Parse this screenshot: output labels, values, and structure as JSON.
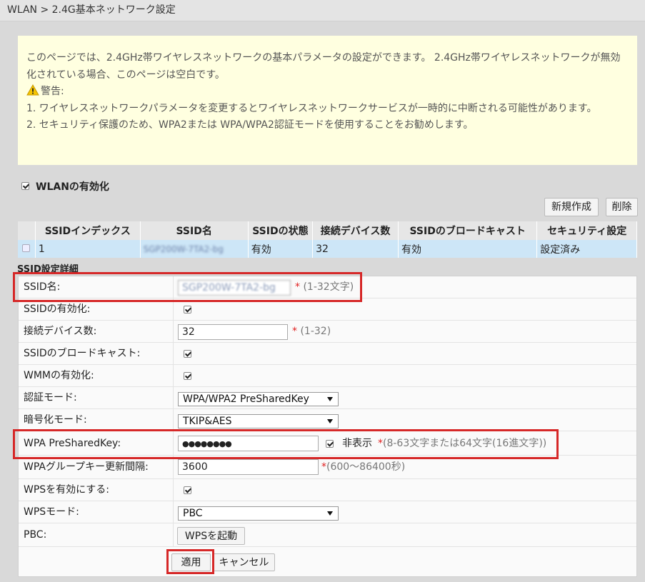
{
  "breadcrumb": "WLAN > 2.4G基本ネットワーク設定",
  "notice": {
    "line1": "このページでは、2.4GHz帯ワイヤレスネットワークの基本パラメータの設定ができます。 2.4GHz帯ワイヤレスネットワークが無効化されている場合、このページは空白です。",
    "warning_label": "警告:",
    "item1": "1. ワイヤレスネットワークパラメータを変更するとワイヤレスネットワークサービスが一時的に中断される可能性があります。",
    "item2": "2. セキュリティ保護のため、WPA2または WPA/WPA2認証モードを使用することをお勧めします。"
  },
  "wlan_enable": {
    "label": "WLANの有効化",
    "checked": true
  },
  "buttons": {
    "new": "新規作成",
    "delete": "削除",
    "wps_start": "WPSを起動",
    "apply": "適用",
    "cancel": "キャンセル"
  },
  "ssid_table": {
    "headers": [
      "",
      "SSIDインデックス",
      "SSID名",
      "SSIDの状態",
      "接続デバイス数",
      "SSIDのブロードキャスト",
      "セキュリティ設定"
    ],
    "rows": [
      {
        "index": "1",
        "name": "SGP200W-7TA2-bg",
        "status": "有効",
        "devices": "32",
        "broadcast": "有効",
        "security": "設定済み"
      }
    ]
  },
  "detail": {
    "title": "SSID設定詳細",
    "ssid_name": {
      "label": "SSID名:",
      "value": "SGP200W-7TA2-bg",
      "hint": "(1-32文字)"
    },
    "ssid_enable": {
      "label": "SSIDの有効化:"
    },
    "devices": {
      "label": "接続デバイス数:",
      "value": "32",
      "hint": "(1-32)"
    },
    "broadcast": {
      "label": "SSIDのブロードキャスト:"
    },
    "wmm": {
      "label": "WMMの有効化:"
    },
    "auth_mode": {
      "label": "認証モード:",
      "value": "WPA/WPA2 PreSharedKey"
    },
    "encrypt_mode": {
      "label": "暗号化モード:",
      "value": "TKIP&AES"
    },
    "psk": {
      "label": "WPA PreSharedKey:",
      "value": "●●●●●●●●",
      "hide_label": "非表示",
      "hint": "(8-63文字または64文字(16進文字))"
    },
    "group_key": {
      "label": "WPAグループキー更新間隔:",
      "value": "3600",
      "hint": "(600～86400秒)"
    },
    "wps_enable": {
      "label": "WPSを有効にする:"
    },
    "wps_mode": {
      "label": "WPSモード:",
      "value": "PBC"
    },
    "pbc": {
      "label": "PBC:"
    }
  },
  "colors": {
    "highlight_box": "#d62828",
    "notice_bg": "#ffffe0",
    "selected_row": "#cde6f7",
    "required_star": "#e02020"
  }
}
